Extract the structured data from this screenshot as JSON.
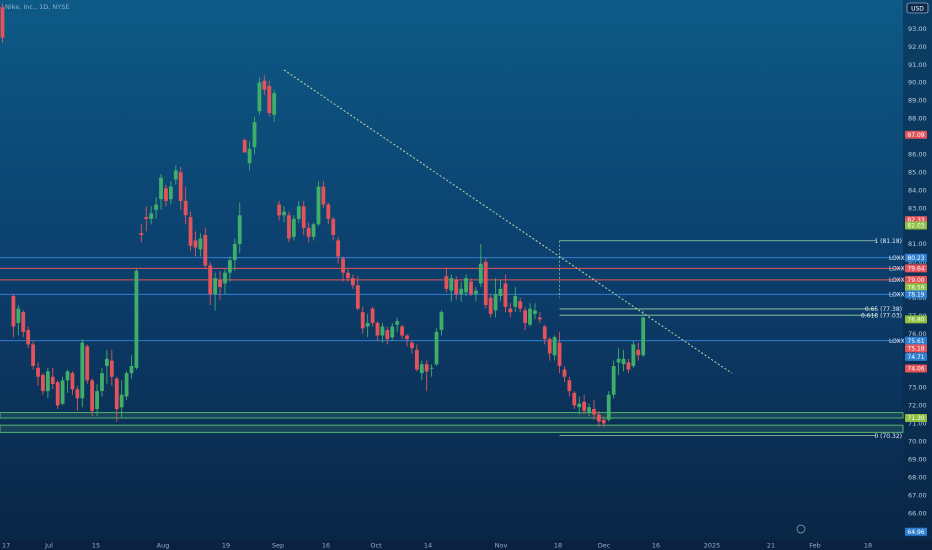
{
  "header": {
    "symbol_text": "Nike, Inc., 1D, NYSE",
    "currency": "USD"
  },
  "colors": {
    "up": "#3fae6a",
    "down": "#e4535a",
    "hline_red": "#e4535a",
    "hline_blue": "#2f7fd1",
    "zone_green": "#5fbf72",
    "fib": "#9fd3a8",
    "trend": "#c8d6a8"
  },
  "chart_data": {
    "type": "candlestick",
    "ylim": [
      64.5,
      94.6
    ],
    "y_ticks": [
      65,
      66,
      67,
      68,
      69,
      70,
      71,
      72,
      73,
      74,
      75,
      76,
      77,
      78,
      79,
      80,
      81,
      82,
      83,
      84,
      85,
      86,
      87,
      88,
      89,
      90,
      91,
      92,
      93
    ],
    "y_tick_labels": [
      "65.00",
      "66.00",
      "67.00",
      "68.00",
      "69.00",
      "70.00",
      "71.00",
      "72.00",
      "73.00",
      "74.00",
      "75.00",
      "76.00",
      "77.00",
      "78.00",
      "79.00",
      "80.00",
      "81.00",
      "82.00",
      "83.00",
      "84.00",
      "85.00",
      "86.00",
      "87.00",
      "88.00",
      "89.00",
      "90.00",
      "91.00",
      "92.00",
      "93.00"
    ],
    "x_ticks": [
      "17",
      "Jul",
      "15",
      "Aug",
      "19",
      "Sep",
      "16",
      "Oct",
      "14",
      "Nov",
      "18",
      "Dec",
      "16",
      "2025",
      "21",
      "Feb",
      "18"
    ],
    "candles": [
      [
        94.2,
        94.4,
        92.2,
        92.5
      ],
      [
        78.1,
        78.2,
        75.8,
        76.4
      ],
      [
        76.6,
        77.6,
        75.9,
        77.4
      ],
      [
        77.2,
        77.3,
        75.8,
        76.1
      ],
      [
        76.2,
        76.4,
        75.2,
        75.4
      ],
      [
        75.4,
        75.6,
        74.0,
        74.2
      ],
      [
        74.1,
        74.4,
        73.1,
        73.6
      ],
      [
        73.7,
        73.8,
        72.6,
        72.8
      ],
      [
        72.8,
        74.1,
        72.4,
        73.9
      ],
      [
        73.6,
        74.1,
        72.9,
        73.2
      ],
      [
        73.3,
        73.4,
        71.8,
        72.0
      ],
      [
        72.1,
        73.6,
        72.0,
        73.4
      ],
      [
        73.4,
        74.0,
        72.7,
        73.9
      ],
      [
        73.8,
        73.9,
        72.6,
        72.9
      ],
      [
        72.9,
        73.1,
        71.7,
        72.4
      ],
      [
        72.4,
        75.7,
        71.9,
        75.5
      ],
      [
        75.3,
        75.4,
        73.2,
        73.4
      ],
      [
        73.4,
        73.5,
        71.4,
        71.7
      ],
      [
        71.8,
        73.2,
        71.4,
        72.8
      ],
      [
        72.8,
        74.1,
        72.5,
        73.8
      ],
      [
        74.2,
        75.1,
        73.2,
        74.6
      ],
      [
        74.5,
        75.1,
        73.1,
        73.6
      ],
      [
        73.5,
        73.6,
        71.1,
        71.8
      ],
      [
        71.9,
        73.4,
        71.3,
        72.6
      ],
      [
        72.5,
        73.9,
        72.3,
        73.8
      ],
      [
        73.8,
        74.8,
        73.5,
        74.2
      ],
      [
        74.1,
        79.6,
        74.0,
        79.5
      ],
      [
        81.6,
        82.1,
        81.1,
        81.5
      ],
      [
        82.5,
        83.1,
        81.7,
        82.4
      ],
      [
        82.4,
        83.1,
        82.1,
        82.7
      ],
      [
        82.9,
        83.6,
        82.4,
        83.2
      ],
      [
        83.5,
        84.9,
        82.9,
        84.7
      ],
      [
        84.1,
        84.3,
        83.1,
        83.4
      ],
      [
        83.5,
        84.5,
        83.2,
        84.2
      ],
      [
        84.6,
        85.4,
        84.3,
        85.1
      ],
      [
        85.0,
        85.3,
        82.9,
        83.4
      ],
      [
        83.4,
        84.2,
        82.1,
        82.6
      ],
      [
        82.5,
        82.8,
        80.6,
        80.9
      ],
      [
        81.2,
        81.7,
        80.3,
        80.8
      ],
      [
        80.7,
        81.6,
        80.3,
        81.3
      ],
      [
        81.5,
        81.9,
        79.6,
        79.8
      ],
      [
        79.8,
        80.0,
        77.6,
        78.2
      ],
      [
        78.2,
        79.4,
        77.3,
        79.1
      ],
      [
        79.0,
        79.5,
        77.9,
        78.6
      ],
      [
        78.8,
        79.6,
        78.2,
        79.4
      ],
      [
        79.4,
        80.3,
        78.9,
        80.1
      ],
      [
        80.1,
        81.3,
        79.5,
        81.0
      ],
      [
        81.0,
        83.3,
        80.5,
        82.6
      ],
      [
        86.8,
        86.9,
        86.1,
        86.1
      ],
      [
        85.5,
        86.7,
        85.1,
        86.3
      ],
      [
        86.4,
        88.1,
        86.0,
        87.8
      ],
      [
        88.4,
        90.3,
        88.2,
        90.0
      ],
      [
        90.1,
        90.4,
        89.3,
        89.6
      ],
      [
        89.8,
        90.1,
        88.1,
        88.3
      ],
      [
        88.2,
        89.6,
        87.8,
        89.4
      ],
      [
        83.2,
        83.4,
        82.3,
        82.6
      ],
      [
        82.6,
        83.1,
        82.2,
        82.8
      ],
      [
        82.6,
        82.8,
        81.1,
        81.3
      ],
      [
        81.4,
        82.6,
        81.2,
        82.4
      ],
      [
        82.4,
        83.4,
        82.2,
        83.1
      ],
      [
        83.1,
        83.4,
        81.5,
        81.9
      ],
      [
        81.9,
        82.2,
        81.1,
        81.4
      ],
      [
        81.4,
        82.2,
        81.2,
        82.1
      ],
      [
        82.1,
        84.5,
        82.0,
        84.2
      ],
      [
        84.2,
        84.5,
        83.0,
        83.2
      ],
      [
        83.2,
        83.3,
        82.1,
        82.4
      ],
      [
        82.4,
        82.5,
        81.2,
        81.5
      ],
      [
        81.2,
        81.4,
        79.9,
        80.3
      ],
      [
        80.2,
        80.3,
        78.9,
        79.4
      ],
      [
        79.4,
        79.6,
        78.9,
        79.1
      ],
      [
        79.1,
        79.3,
        78.5,
        78.7
      ],
      [
        78.7,
        79.2,
        77.3,
        77.4
      ],
      [
        77.2,
        77.5,
        76.0,
        76.3
      ],
      [
        76.4,
        77.1,
        75.8,
        76.6
      ],
      [
        77.4,
        77.5,
        76.4,
        76.6
      ],
      [
        76.6,
        76.7,
        75.6,
        75.9
      ],
      [
        75.9,
        76.6,
        75.5,
        76.4
      ],
      [
        76.2,
        76.4,
        75.4,
        75.7
      ],
      [
        75.8,
        76.6,
        75.6,
        76.4
      ],
      [
        76.5,
        76.9,
        76.1,
        76.7
      ],
      [
        76.4,
        76.5,
        75.7,
        75.9
      ],
      [
        75.9,
        76.0,
        75.3,
        75.7
      ],
      [
        75.5,
        75.6,
        74.9,
        75.2
      ],
      [
        75.1,
        75.4,
        73.9,
        74.0
      ],
      [
        73.8,
        74.5,
        73.4,
        74.3
      ],
      [
        74.3,
        74.5,
        72.8,
        73.9
      ],
      [
        74.1,
        74.3,
        73.6,
        74.1
      ],
      [
        74.3,
        76.3,
        74.2,
        76.1
      ],
      [
        76.2,
        77.3,
        75.9,
        77.2
      ],
      [
        79.2,
        79.7,
        78.3,
        78.5
      ],
      [
        78.4,
        79.3,
        77.8,
        79.1
      ],
      [
        79.0,
        79.2,
        77.9,
        78.2
      ],
      [
        78.2,
        78.9,
        77.8,
        78.5
      ],
      [
        78.3,
        79.3,
        78.1,
        79.1
      ],
      [
        78.9,
        79.1,
        78.1,
        78.2
      ],
      [
        78.2,
        78.6,
        77.8,
        78.4
      ],
      [
        78.8,
        81.0,
        78.6,
        79.9
      ],
      [
        80.0,
        80.2,
        77.4,
        77.6
      ],
      [
        78.0,
        78.2,
        76.9,
        77.1
      ],
      [
        77.3,
        79.1,
        76.9,
        78.2
      ],
      [
        78.1,
        79.0,
        77.8,
        78.5
      ],
      [
        78.8,
        79.3,
        77.2,
        77.5
      ],
      [
        77.4,
        77.7,
        76.9,
        77.2
      ],
      [
        77.5,
        78.6,
        77.2,
        78.1
      ],
      [
        77.8,
        78.0,
        77.2,
        77.4
      ],
      [
        77.3,
        77.5,
        76.2,
        76.6
      ],
      [
        76.5,
        77.7,
        76.4,
        77.4
      ],
      [
        77.1,
        77.7,
        76.8,
        77.3
      ],
      [
        76.9,
        77.2,
        76.6,
        76.8
      ],
      [
        76.4,
        76.5,
        75.4,
        75.7
      ],
      [
        75.7,
        75.8,
        74.5,
        74.9
      ],
      [
        74.8,
        75.9,
        74.5,
        75.8
      ],
      [
        75.5,
        76.1,
        73.8,
        74.2
      ],
      [
        74.0,
        74.2,
        73.3,
        73.6
      ],
      [
        73.4,
        73.6,
        72.5,
        72.8
      ],
      [
        72.7,
        72.8,
        71.8,
        72.0
      ],
      [
        71.9,
        72.5,
        71.5,
        72.1
      ],
      [
        72.2,
        72.6,
        71.5,
        71.7
      ],
      [
        71.6,
        72.1,
        71.4,
        71.9
      ],
      [
        71.8,
        72.3,
        71.2,
        71.5
      ],
      [
        71.5,
        71.7,
        70.8,
        71.1
      ],
      [
        71.2,
        71.4,
        70.8,
        71.0
      ],
      [
        71.2,
        72.8,
        71.1,
        72.6
      ],
      [
        72.6,
        74.5,
        72.4,
        74.2
      ],
      [
        74.4,
        75.2,
        73.7,
        74.6
      ],
      [
        74.3,
        75.1,
        73.9,
        74.6
      ],
      [
        74.4,
        74.6,
        73.8,
        74.0
      ],
      [
        74.2,
        75.6,
        74.1,
        75.4
      ],
      [
        75.1,
        75.5,
        74.5,
        74.8
      ],
      [
        74.8,
        77.3,
        74.7,
        76.9
      ]
    ],
    "horizontal_lines": [
      {
        "value": 80.24,
        "kind": "blue",
        "text": "LOXX"
      },
      {
        "value": 79.64,
        "kind": "red",
        "text": "LOXX"
      },
      {
        "value": 79.0,
        "kind": "red",
        "text": "LOXX"
      },
      {
        "value": 78.19,
        "kind": "blue",
        "text": "LOXX"
      },
      {
        "value": 75.61,
        "kind": "blue",
        "text": "LOXX"
      }
    ],
    "zones": [
      [
        71.3,
        71.6
      ],
      [
        70.5,
        70.9
      ]
    ],
    "fib_levels": [
      {
        "label": "1 (81.18)",
        "value": 81.18
      },
      {
        "label": "0.65 (77.38)",
        "value": 77.38
      },
      {
        "label": "0.618 (77.03)",
        "value": 77.03
      },
      {
        "label": "0 (70.32)",
        "value": 70.32
      }
    ],
    "trendline": {
      "from": {
        "index": 56,
        "value": 90.7
      },
      "to": {
        "index": 147,
        "value": 73.8
      }
    },
    "price_badges": [
      {
        "value": 87.09,
        "color": "#e4535a",
        "text": "87.09"
      },
      {
        "value": 82.33,
        "color": "#e4535a",
        "text": "82.33"
      },
      {
        "value": 82.03,
        "color": "#8cbf3f",
        "text": "82.03"
      },
      {
        "value": 80.23,
        "color": "#2f7fd1",
        "text": "80.23"
      },
      {
        "value": 79.64,
        "color": "#e4535a",
        "text": "79.64"
      },
      {
        "value": 79.0,
        "color": "#e4535a",
        "text": "79.00"
      },
      {
        "value": 78.59,
        "color": "#8cbf3f",
        "text": "78.59"
      },
      {
        "value": 78.19,
        "color": "#2f7fd1",
        "text": "78.19"
      },
      {
        "value": 76.8,
        "color": "#8cbf3f",
        "text": "76.80"
      },
      {
        "value": 75.61,
        "color": "#2f7fd1",
        "text": "75.61"
      },
      {
        "value": 75.18,
        "color": "#e4535a",
        "text": "75.18"
      },
      {
        "value": 74.71,
        "color": "#2f7fd1",
        "text": "74.71"
      },
      {
        "value": 74.06,
        "color": "#e4535a",
        "text": "74.06"
      },
      {
        "value": 71.3,
        "color": "#8cbf3f",
        "text": "71.30"
      },
      {
        "value": 64.96,
        "color": "#2f7fd1",
        "text": "64.96"
      }
    ]
  }
}
